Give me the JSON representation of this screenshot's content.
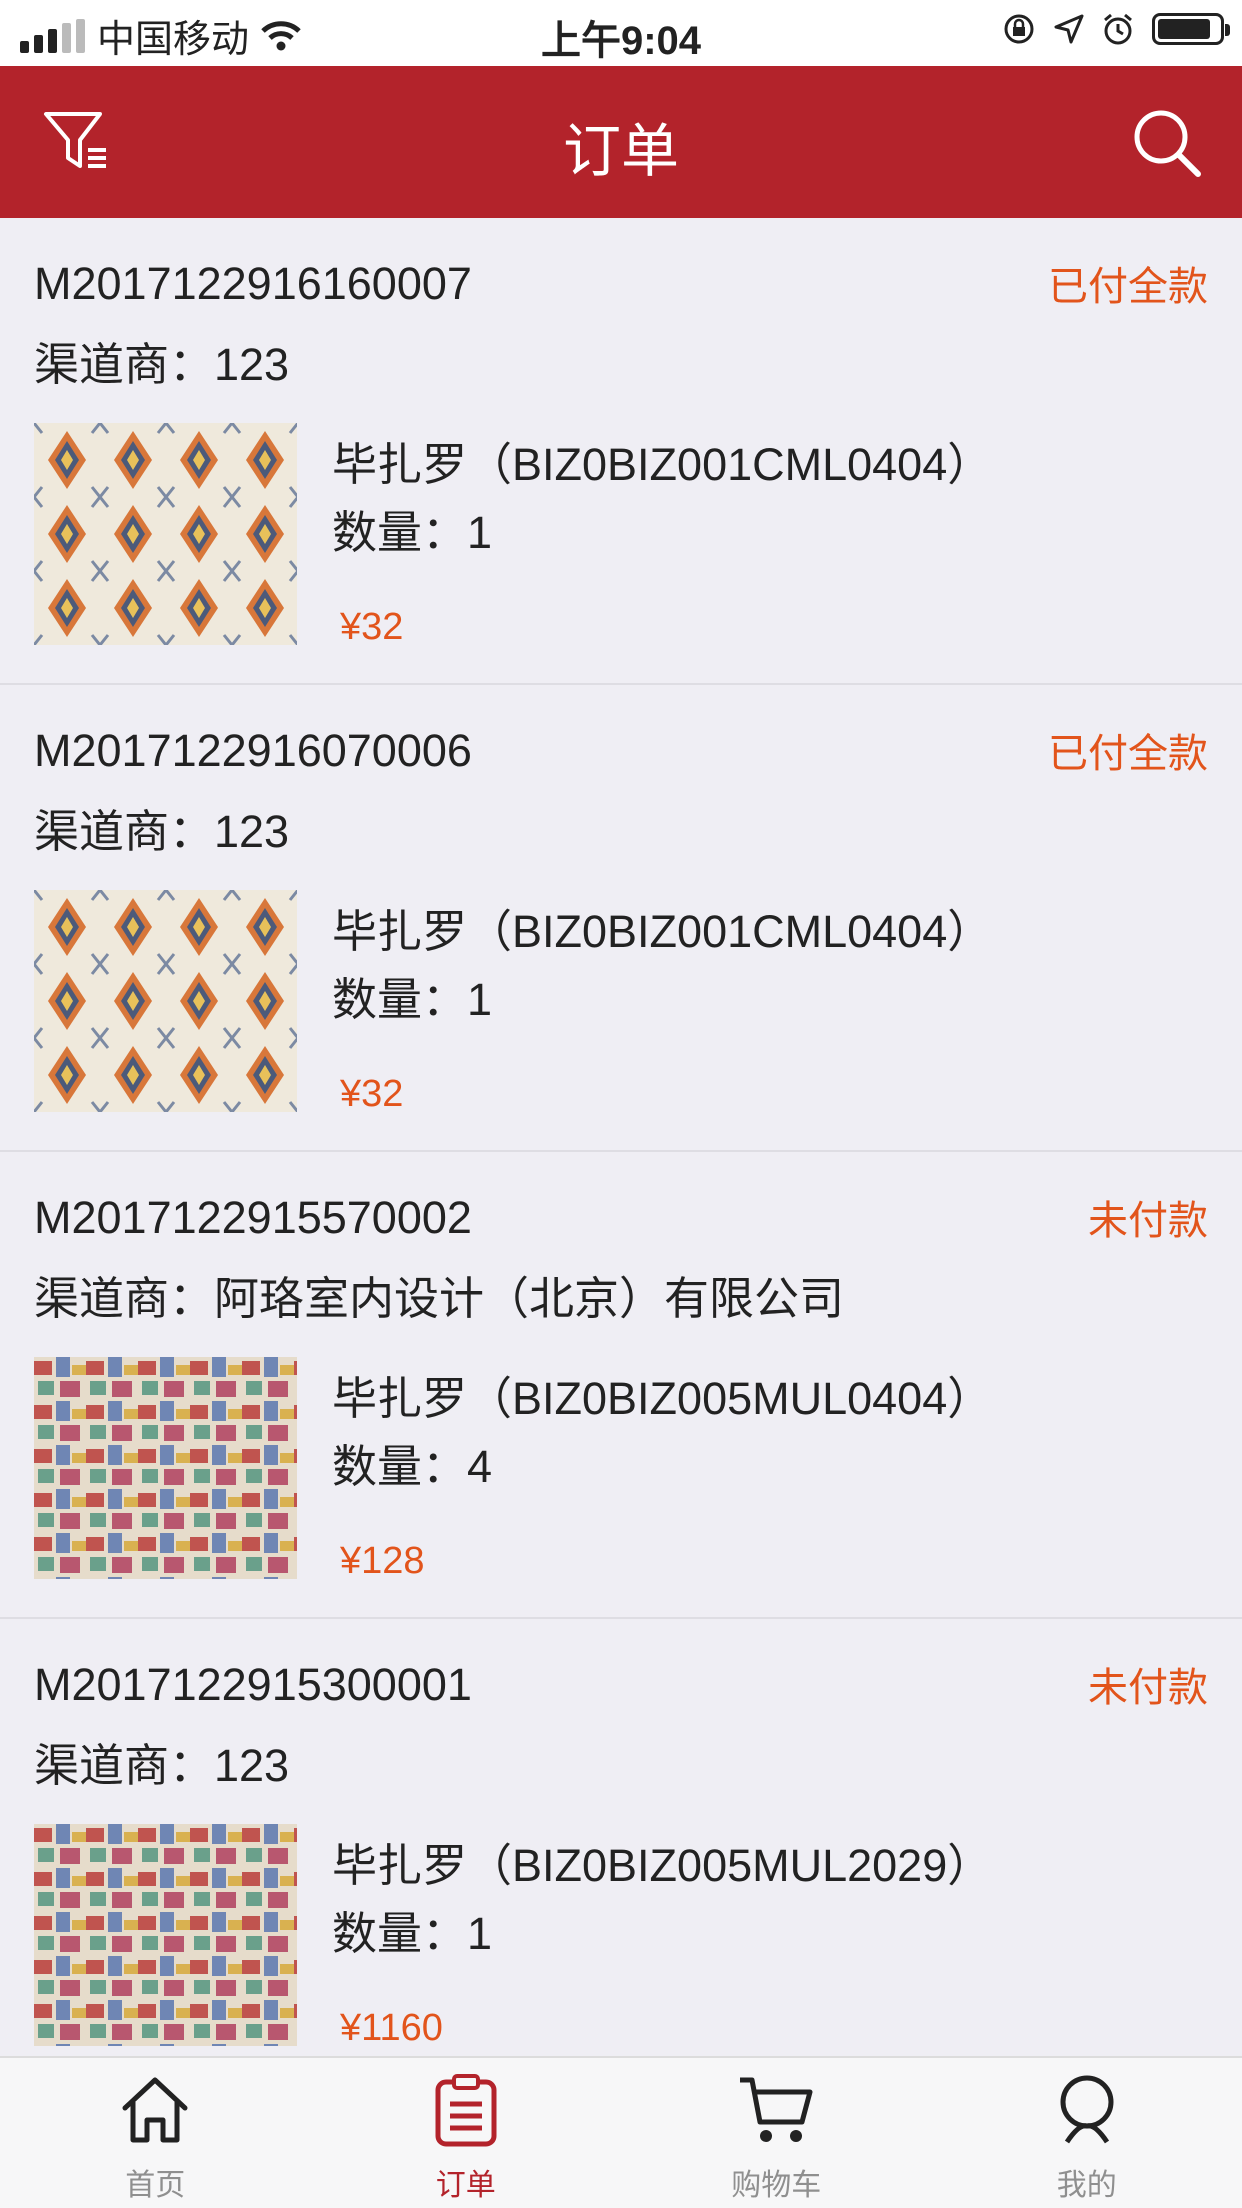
{
  "status_bar": {
    "carrier": "中国移动",
    "time": "上午9:04"
  },
  "navbar": {
    "title": "订单",
    "filter_icon": "filter-icon",
    "search_icon": "search-icon"
  },
  "orders": [
    {
      "order_no": "M2017122916160007",
      "status": "已付全款",
      "dealer": "渠道商：123",
      "product": "毕扎罗（BIZ0BIZ001CML0404）",
      "quantity": "数量：1",
      "price": "¥32",
      "thumb": "diamond-rug"
    },
    {
      "order_no": "M2017122916070006",
      "status": "已付全款",
      "dealer": "渠道商：123",
      "product": "毕扎罗（BIZ0BIZ001CML0404）",
      "quantity": "数量：1",
      "price": "¥32",
      "thumb": "diamond-rug"
    },
    {
      "order_no": "M2017122915570002",
      "status": "未付款",
      "dealer": "渠道商：阿珞室内设计（北京）有限公司",
      "product": "毕扎罗（BIZ0BIZ005MUL0404）",
      "quantity": "数量：4",
      "price": "¥128",
      "thumb": "ikat-rug"
    },
    {
      "order_no": "M2017122915300001",
      "status": "未付款",
      "dealer": "渠道商：123",
      "product": "毕扎罗（BIZ0BIZ005MUL2029）",
      "quantity": "数量：1",
      "price": "¥1160",
      "thumb": "ikat-rug"
    }
  ],
  "tabbar": {
    "items": [
      {
        "label": "首页",
        "icon": "home-icon",
        "active": false
      },
      {
        "label": "订单",
        "icon": "clipboard-icon",
        "active": true
      },
      {
        "label": "购物车",
        "icon": "cart-icon",
        "active": false
      },
      {
        "label": "我的",
        "icon": "user-icon",
        "active": false
      }
    ]
  },
  "colors": {
    "brand": "#b3232b",
    "status_text": "#e2541b",
    "background": "#efeef4"
  }
}
